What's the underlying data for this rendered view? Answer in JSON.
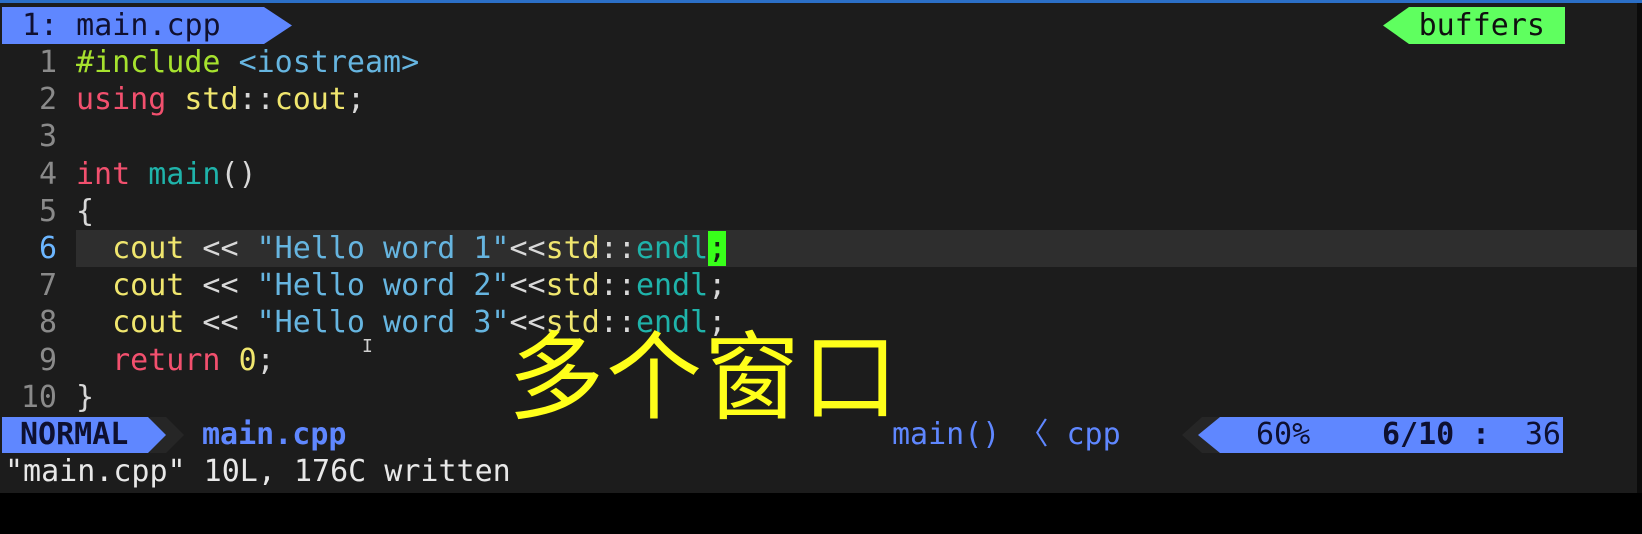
{
  "tabline": {
    "active_tab": "1: main.cpp",
    "right_label": "buffers"
  },
  "editor": {
    "current_line": 6,
    "lines": [
      {
        "num": "1",
        "tokens": [
          {
            "t": "#include ",
            "c": "pre"
          },
          {
            "t": "<iostream>",
            "c": "inc"
          }
        ]
      },
      {
        "num": "2",
        "tokens": [
          {
            "t": "using ",
            "c": "kw"
          },
          {
            "t": "std",
            "c": "id"
          },
          {
            "t": "::",
            "c": "op"
          },
          {
            "t": "cout",
            "c": "id"
          },
          {
            "t": ";",
            "c": "punct"
          }
        ]
      },
      {
        "num": "3",
        "tokens": []
      },
      {
        "num": "4",
        "tokens": [
          {
            "t": "int ",
            "c": "type"
          },
          {
            "t": "main",
            "c": "fn"
          },
          {
            "t": "()",
            "c": "punct"
          }
        ]
      },
      {
        "num": "5",
        "tokens": [
          {
            "t": "{",
            "c": "punct"
          }
        ]
      },
      {
        "num": "6",
        "tokens": [
          {
            "t": "  cout",
            "c": "id"
          },
          {
            "t": " << ",
            "c": "op"
          },
          {
            "t": "\"Hello word 1\"",
            "c": "str"
          },
          {
            "t": "<<",
            "c": "op"
          },
          {
            "t": "std",
            "c": "id"
          },
          {
            "t": "::",
            "c": "op"
          },
          {
            "t": "endl",
            "c": "fn"
          },
          {
            "t": ";",
            "c": "cursor"
          }
        ]
      },
      {
        "num": "7",
        "tokens": [
          {
            "t": "  cout",
            "c": "id"
          },
          {
            "t": " << ",
            "c": "op"
          },
          {
            "t": "\"Hello word 2\"",
            "c": "str"
          },
          {
            "t": "<<",
            "c": "op"
          },
          {
            "t": "std",
            "c": "id"
          },
          {
            "t": "::",
            "c": "op"
          },
          {
            "t": "endl",
            "c": "fn"
          },
          {
            "t": ";",
            "c": "punct"
          }
        ]
      },
      {
        "num": "8",
        "tokens": [
          {
            "t": "  cout",
            "c": "id"
          },
          {
            "t": " << ",
            "c": "op"
          },
          {
            "t": "\"Hello word 3\"",
            "c": "str"
          },
          {
            "t": "<<",
            "c": "op"
          },
          {
            "t": "std",
            "c": "id"
          },
          {
            "t": "::",
            "c": "op"
          },
          {
            "t": "endl",
            "c": "fn"
          },
          {
            "t": ";",
            "c": "punct"
          }
        ]
      },
      {
        "num": "9",
        "tokens": [
          {
            "t": "  return ",
            "c": "kw"
          },
          {
            "t": "0",
            "c": "num"
          },
          {
            "t": ";",
            "c": "punct"
          }
        ]
      },
      {
        "num": "10",
        "tokens": [
          {
            "t": "}",
            "c": "punct"
          }
        ]
      }
    ]
  },
  "overlay": {
    "caption": "多个窗口",
    "mouse_cursor": "I"
  },
  "statusline": {
    "mode": "NORMAL",
    "filename": "main.cpp",
    "function_context": "main() 〈 cpp",
    "percent": "60%",
    "line_pos": "6/10",
    "col_sep": ":",
    "column": "36"
  },
  "cmdline": {
    "message": "\"main.cpp\" 10L, 176C written"
  },
  "colors": {
    "accent_blue": "#5f87ff",
    "accent_green": "#5fff5f",
    "cursor_green": "#38ff1a",
    "caption_yellow": "#ffff1a"
  }
}
